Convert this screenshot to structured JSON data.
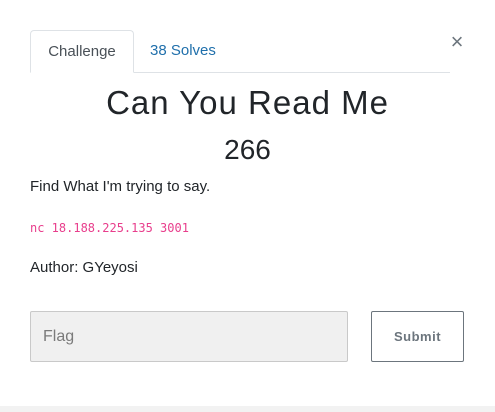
{
  "tabs": {
    "challenge_label": "Challenge",
    "solves_label": "38 Solves"
  },
  "close_glyph": "×",
  "challenge": {
    "name": "Can You Read Me",
    "points": "266",
    "description": "Find What I'm trying to say.",
    "connection": "nc 18.188.225.135 3001",
    "author": "Author: GYeyosi"
  },
  "form": {
    "flag_placeholder": "Flag",
    "flag_value": "",
    "submit_label": "Submit"
  },
  "colors": {
    "link": "#1f6fab",
    "code": "#e83e8c",
    "input_bg": "#f0f0f0"
  }
}
